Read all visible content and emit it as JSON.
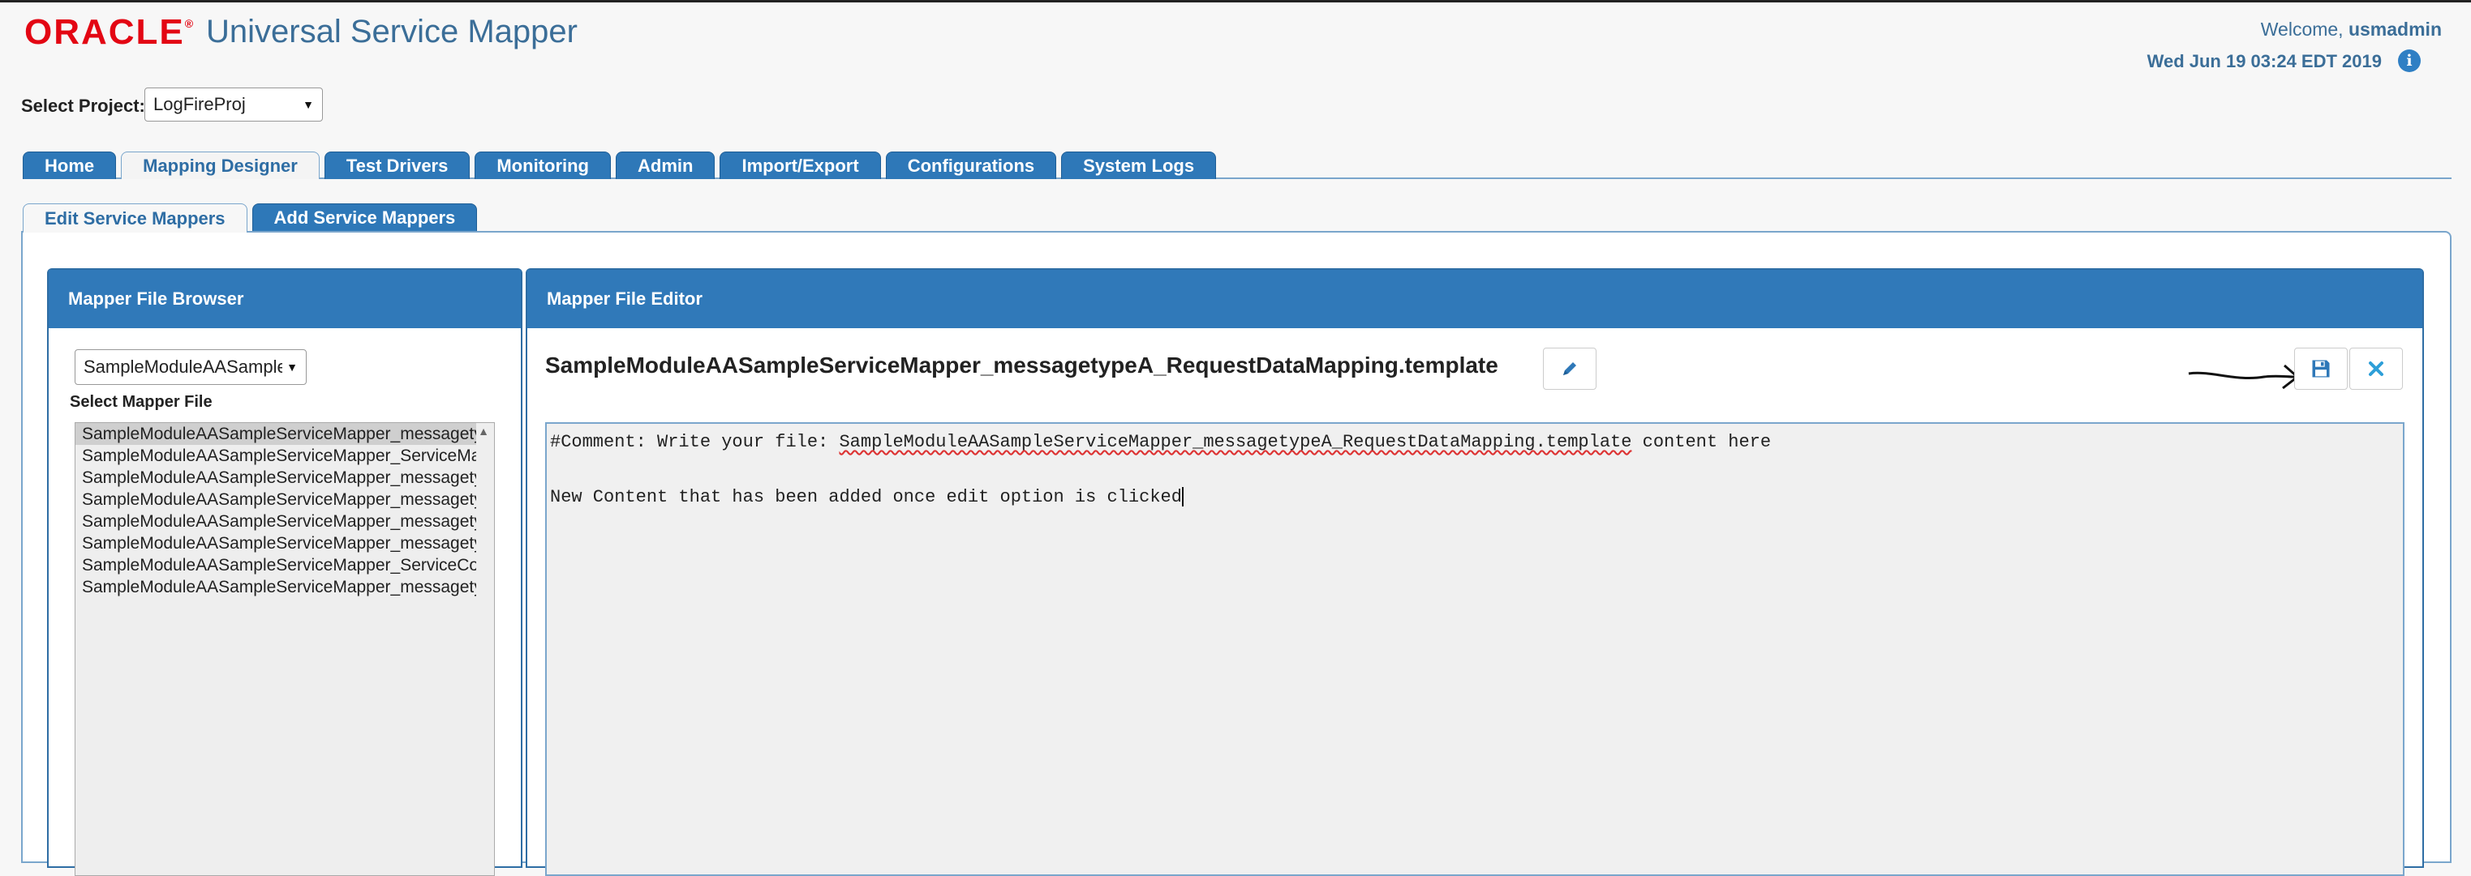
{
  "header": {
    "logo": "ORACLE",
    "app_title": "Universal Service Mapper",
    "welcome_prefix": "Welcome,",
    "username": "usmadmin",
    "datetime": "Wed Jun 19 03:24 EDT 2019",
    "info_icon": "info-icon"
  },
  "project": {
    "label": "Select Project:",
    "selected": "LogFireProj"
  },
  "main_tabs": [
    {
      "label": "Home",
      "active": false
    },
    {
      "label": "Mapping Designer",
      "active": true
    },
    {
      "label": "Test Drivers",
      "active": false
    },
    {
      "label": "Monitoring",
      "active": false
    },
    {
      "label": "Admin",
      "active": false
    },
    {
      "label": "Import/Export",
      "active": false
    },
    {
      "label": "Configurations",
      "active": false
    },
    {
      "label": "System Logs",
      "active": false
    }
  ],
  "sub_tabs": [
    {
      "label": "Edit Service Mappers",
      "active": true
    },
    {
      "label": "Add Service Mappers",
      "active": false
    }
  ],
  "browser": {
    "title": "Mapper File Browser",
    "module_selected": "SampleModuleAASampleServiceMapper",
    "select_label": "Select Mapper File",
    "files": [
      "SampleModuleAASampleServiceMapper_messagetypeA_RequestDataMapping.template",
      "SampleModuleAASampleServiceMapper_ServiceMapping.properties",
      "SampleModuleAASampleServiceMapper_messagetypeA_ResponseDataMapping.template",
      "SampleModuleAASampleServiceMapper_messagetypeB_RequestDataMapping.template",
      "SampleModuleAASampleServiceMapper_messagetypeB_ResponseDataMapping.template",
      "SampleModuleAASampleServiceMapper_messagetypeC_RequestDataMapping.template",
      "SampleModuleAASampleServiceMapper_ServiceConfig.properties",
      "SampleModuleAASampleServiceMapper_messagetypeC_ResponseDataMapping.template"
    ]
  },
  "editor": {
    "title": "Mapper File Editor",
    "filename": "SampleModuleAASampleServiceMapper_messagetypeA_RequestDataMapping.template",
    "line1_prefix": "#Comment: Write your file: ",
    "line1_file": "SampleModuleAASampleServiceMapper_messagetypeA_RequestDataMapping.template",
    "line1_suffix": " content here",
    "line2": "New Content that has been added once edit option is clicked",
    "icons": {
      "edit": "pencil-icon",
      "save": "floppy-save-icon",
      "cancel": "close-icon"
    }
  },
  "colors": {
    "accent": "#3079b9",
    "logo": "#e30613",
    "title": "#3b6e98"
  }
}
